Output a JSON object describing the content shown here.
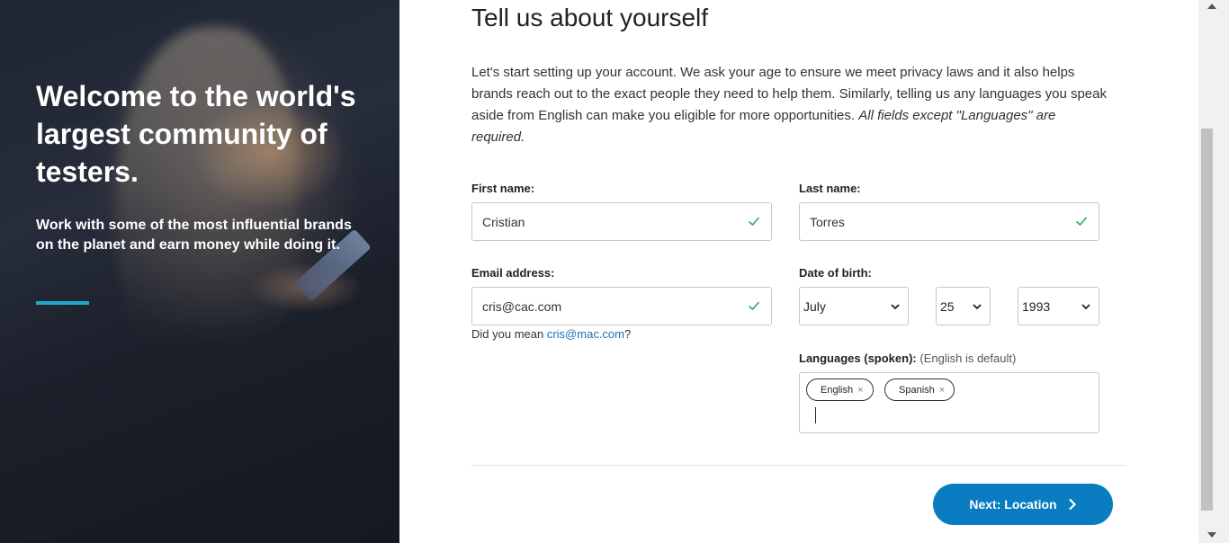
{
  "hero": {
    "title": "Welcome to the world's largest community of testers.",
    "subtitle": "Work with some of the most influential brands on the planet and earn money while doing it.",
    "accent_color": "#1fa9c8"
  },
  "form": {
    "title": "Tell us about yourself",
    "intro": "Let's start setting up your account. We ask your age to ensure we meet privacy laws and it also helps brands reach out to the exact people they need to help them. Similarly, telling us any languages you speak aside from English can make you eligible for more opportunities.",
    "intro_italic": "All fields except \"Languages\" are required.",
    "first_name": {
      "label": "First name:",
      "value": "Cristian"
    },
    "last_name": {
      "label": "Last name:",
      "value": "Torres"
    },
    "email": {
      "label": "Email address:",
      "value": "cris@cac.com"
    },
    "suggestion": {
      "prefix": "Did you mean",
      "link": "cris@mac.com",
      "suffix": "?"
    },
    "dob": {
      "label": "Date of birth:",
      "month": "July",
      "day": "25",
      "year": "1993"
    },
    "languages": {
      "label": "Languages (spoken):",
      "hint": "(English is default)",
      "tags": [
        {
          "label": "English",
          "remove": "×"
        },
        {
          "label": "Spanish",
          "remove": "×"
        }
      ]
    },
    "next_button": "Next: Location",
    "valid_color": "#2eaa5c",
    "button_color": "#0a7cc1"
  }
}
